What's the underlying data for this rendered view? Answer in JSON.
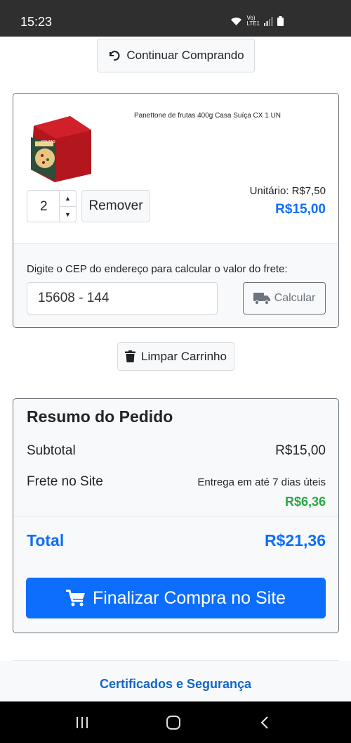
{
  "status_bar": {
    "time": "15:23",
    "network_label": "Vo)\nLTE1"
  },
  "continue_button": {
    "label": "Continuar Comprando",
    "icon": "undo-icon"
  },
  "cart_item": {
    "product_name": "Panettone de frutas 400g Casa Suíça CX 1 UN",
    "quantity": "2",
    "remove_label": "Remover",
    "unit_price": "Unitário: R$7,50",
    "total_price": "R$15,00",
    "image_text": "FRUTAS"
  },
  "shipping": {
    "prompt": "Digite o CEP do endereço para calcular o valor do frete:",
    "cep_value": "15608 - 144",
    "calculate_label": "Calcular",
    "icon": "truck-icon"
  },
  "clear_cart": {
    "label": "Limpar Carrinho",
    "icon": "trash-icon"
  },
  "summary": {
    "title": "Resumo do Pedido",
    "subtotal_label": "Subtotal",
    "subtotal_value": "R$15,00",
    "shipping_label": "Frete no Site",
    "delivery_note": "Entrega em até 7 dias úteis",
    "shipping_value": "R$6,36",
    "total_label": "Total",
    "total_value": "R$21,36",
    "checkout_label": "Finalizar Compra no Site",
    "checkout_icon": "cart-icon"
  },
  "footer": {
    "title": "Certificados e Segurança"
  },
  "colors": {
    "primary": "#0d6efd",
    "link_blue": "#1166c8",
    "success": "#28a745"
  }
}
